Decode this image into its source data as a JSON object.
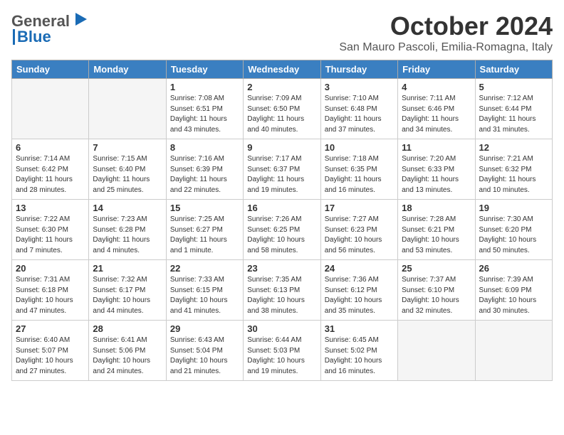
{
  "header": {
    "logo_line1": "General",
    "logo_line2": "Blue",
    "month": "October 2024",
    "location": "San Mauro Pascoli, Emilia-Romagna, Italy"
  },
  "weekdays": [
    "Sunday",
    "Monday",
    "Tuesday",
    "Wednesday",
    "Thursday",
    "Friday",
    "Saturday"
  ],
  "weeks": [
    [
      {
        "day": "",
        "empty": true
      },
      {
        "day": "",
        "empty": true
      },
      {
        "day": "1",
        "sunrise": "Sunrise: 7:08 AM",
        "sunset": "Sunset: 6:51 PM",
        "daylight": "Daylight: 11 hours and 43 minutes."
      },
      {
        "day": "2",
        "sunrise": "Sunrise: 7:09 AM",
        "sunset": "Sunset: 6:50 PM",
        "daylight": "Daylight: 11 hours and 40 minutes."
      },
      {
        "day": "3",
        "sunrise": "Sunrise: 7:10 AM",
        "sunset": "Sunset: 6:48 PM",
        "daylight": "Daylight: 11 hours and 37 minutes."
      },
      {
        "day": "4",
        "sunrise": "Sunrise: 7:11 AM",
        "sunset": "Sunset: 6:46 PM",
        "daylight": "Daylight: 11 hours and 34 minutes."
      },
      {
        "day": "5",
        "sunrise": "Sunrise: 7:12 AM",
        "sunset": "Sunset: 6:44 PM",
        "daylight": "Daylight: 11 hours and 31 minutes."
      }
    ],
    [
      {
        "day": "6",
        "sunrise": "Sunrise: 7:14 AM",
        "sunset": "Sunset: 6:42 PM",
        "daylight": "Daylight: 11 hours and 28 minutes."
      },
      {
        "day": "7",
        "sunrise": "Sunrise: 7:15 AM",
        "sunset": "Sunset: 6:40 PM",
        "daylight": "Daylight: 11 hours and 25 minutes."
      },
      {
        "day": "8",
        "sunrise": "Sunrise: 7:16 AM",
        "sunset": "Sunset: 6:39 PM",
        "daylight": "Daylight: 11 hours and 22 minutes."
      },
      {
        "day": "9",
        "sunrise": "Sunrise: 7:17 AM",
        "sunset": "Sunset: 6:37 PM",
        "daylight": "Daylight: 11 hours and 19 minutes."
      },
      {
        "day": "10",
        "sunrise": "Sunrise: 7:18 AM",
        "sunset": "Sunset: 6:35 PM",
        "daylight": "Daylight: 11 hours and 16 minutes."
      },
      {
        "day": "11",
        "sunrise": "Sunrise: 7:20 AM",
        "sunset": "Sunset: 6:33 PM",
        "daylight": "Daylight: 11 hours and 13 minutes."
      },
      {
        "day": "12",
        "sunrise": "Sunrise: 7:21 AM",
        "sunset": "Sunset: 6:32 PM",
        "daylight": "Daylight: 11 hours and 10 minutes."
      }
    ],
    [
      {
        "day": "13",
        "sunrise": "Sunrise: 7:22 AM",
        "sunset": "Sunset: 6:30 PM",
        "daylight": "Daylight: 11 hours and 7 minutes."
      },
      {
        "day": "14",
        "sunrise": "Sunrise: 7:23 AM",
        "sunset": "Sunset: 6:28 PM",
        "daylight": "Daylight: 11 hours and 4 minutes."
      },
      {
        "day": "15",
        "sunrise": "Sunrise: 7:25 AM",
        "sunset": "Sunset: 6:27 PM",
        "daylight": "Daylight: 11 hours and 1 minute."
      },
      {
        "day": "16",
        "sunrise": "Sunrise: 7:26 AM",
        "sunset": "Sunset: 6:25 PM",
        "daylight": "Daylight: 10 hours and 58 minutes."
      },
      {
        "day": "17",
        "sunrise": "Sunrise: 7:27 AM",
        "sunset": "Sunset: 6:23 PM",
        "daylight": "Daylight: 10 hours and 56 minutes."
      },
      {
        "day": "18",
        "sunrise": "Sunrise: 7:28 AM",
        "sunset": "Sunset: 6:21 PM",
        "daylight": "Daylight: 10 hours and 53 minutes."
      },
      {
        "day": "19",
        "sunrise": "Sunrise: 7:30 AM",
        "sunset": "Sunset: 6:20 PM",
        "daylight": "Daylight: 10 hours and 50 minutes."
      }
    ],
    [
      {
        "day": "20",
        "sunrise": "Sunrise: 7:31 AM",
        "sunset": "Sunset: 6:18 PM",
        "daylight": "Daylight: 10 hours and 47 minutes."
      },
      {
        "day": "21",
        "sunrise": "Sunrise: 7:32 AM",
        "sunset": "Sunset: 6:17 PM",
        "daylight": "Daylight: 10 hours and 44 minutes."
      },
      {
        "day": "22",
        "sunrise": "Sunrise: 7:33 AM",
        "sunset": "Sunset: 6:15 PM",
        "daylight": "Daylight: 10 hours and 41 minutes."
      },
      {
        "day": "23",
        "sunrise": "Sunrise: 7:35 AM",
        "sunset": "Sunset: 6:13 PM",
        "daylight": "Daylight: 10 hours and 38 minutes."
      },
      {
        "day": "24",
        "sunrise": "Sunrise: 7:36 AM",
        "sunset": "Sunset: 6:12 PM",
        "daylight": "Daylight: 10 hours and 35 minutes."
      },
      {
        "day": "25",
        "sunrise": "Sunrise: 7:37 AM",
        "sunset": "Sunset: 6:10 PM",
        "daylight": "Daylight: 10 hours and 32 minutes."
      },
      {
        "day": "26",
        "sunrise": "Sunrise: 7:39 AM",
        "sunset": "Sunset: 6:09 PM",
        "daylight": "Daylight: 10 hours and 30 minutes."
      }
    ],
    [
      {
        "day": "27",
        "sunrise": "Sunrise: 6:40 AM",
        "sunset": "Sunset: 5:07 PM",
        "daylight": "Daylight: 10 hours and 27 minutes."
      },
      {
        "day": "28",
        "sunrise": "Sunrise: 6:41 AM",
        "sunset": "Sunset: 5:06 PM",
        "daylight": "Daylight: 10 hours and 24 minutes."
      },
      {
        "day": "29",
        "sunrise": "Sunrise: 6:43 AM",
        "sunset": "Sunset: 5:04 PM",
        "daylight": "Daylight: 10 hours and 21 minutes."
      },
      {
        "day": "30",
        "sunrise": "Sunrise: 6:44 AM",
        "sunset": "Sunset: 5:03 PM",
        "daylight": "Daylight: 10 hours and 19 minutes."
      },
      {
        "day": "31",
        "sunrise": "Sunrise: 6:45 AM",
        "sunset": "Sunset: 5:02 PM",
        "daylight": "Daylight: 10 hours and 16 minutes."
      },
      {
        "day": "",
        "empty": true
      },
      {
        "day": "",
        "empty": true
      }
    ]
  ]
}
